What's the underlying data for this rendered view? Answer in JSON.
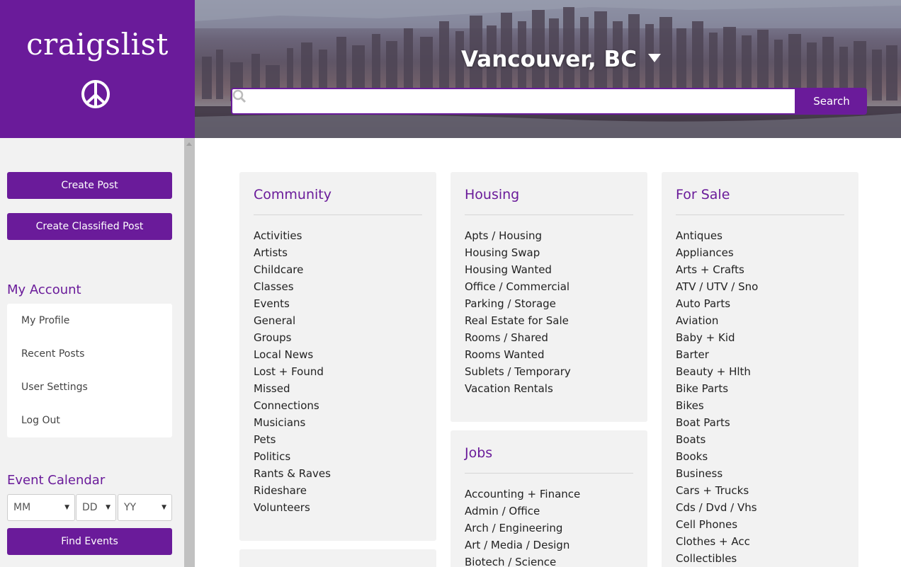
{
  "logo": {
    "text": "craigslist",
    "icon": "peace-icon"
  },
  "header": {
    "city": "Vancouver, BC",
    "search_placeholder": "",
    "search_button": "Search"
  },
  "sidebar": {
    "create_post": "Create Post",
    "create_classified": "Create Classified Post",
    "my_account_title": "My Account",
    "account_items": [
      "My Profile",
      "Recent Posts",
      "User Settings",
      "Log Out"
    ],
    "event_calendar_title": "Event Calendar",
    "selects": {
      "month": "MM",
      "day": "DD",
      "year": "YY"
    },
    "find_events": "Find Events"
  },
  "sections": {
    "community": {
      "title": "Community",
      "items": [
        "Activities",
        "Artists",
        "Childcare",
        "Classes",
        "Events",
        "General",
        "Groups",
        "Local News",
        "Lost + Found",
        "Missed",
        "Connections",
        "Musicians",
        "Pets",
        "Politics",
        "Rants & Raves",
        "Rideshare",
        "Volunteers"
      ]
    },
    "housing": {
      "title": "Housing",
      "items": [
        "Apts / Housing",
        "Housing Swap",
        "Housing Wanted",
        "Office / Commercial",
        "Parking / Storage",
        "Real Estate for Sale",
        "Rooms / Shared",
        "Rooms Wanted",
        "Sublets / Temporary",
        "Vacation Rentals"
      ]
    },
    "jobs": {
      "title": "Jobs",
      "items": [
        "Accounting + Finance",
        "Admin / Office",
        "Arch / Engineering",
        "Art / Media / Design",
        "Biotech / Science"
      ]
    },
    "for_sale": {
      "title": "For Sale",
      "items": [
        "Antiques",
        "Appliances",
        "Arts + Crafts",
        "ATV / UTV / Sno",
        "Auto Parts",
        "Aviation",
        "Baby + Kid",
        "Barter",
        "Beauty + Hlth",
        "Bike Parts",
        "Bikes",
        "Boat Parts",
        "Boats",
        "Books",
        "Business",
        "Cars + Trucks",
        "Cds / Dvd / Vhs",
        "Cell Phones",
        "Clothes + Acc",
        "Collectibles"
      ]
    }
  },
  "colors": {
    "brand": "#6a1b9a",
    "panel": "#f2f2f2"
  }
}
